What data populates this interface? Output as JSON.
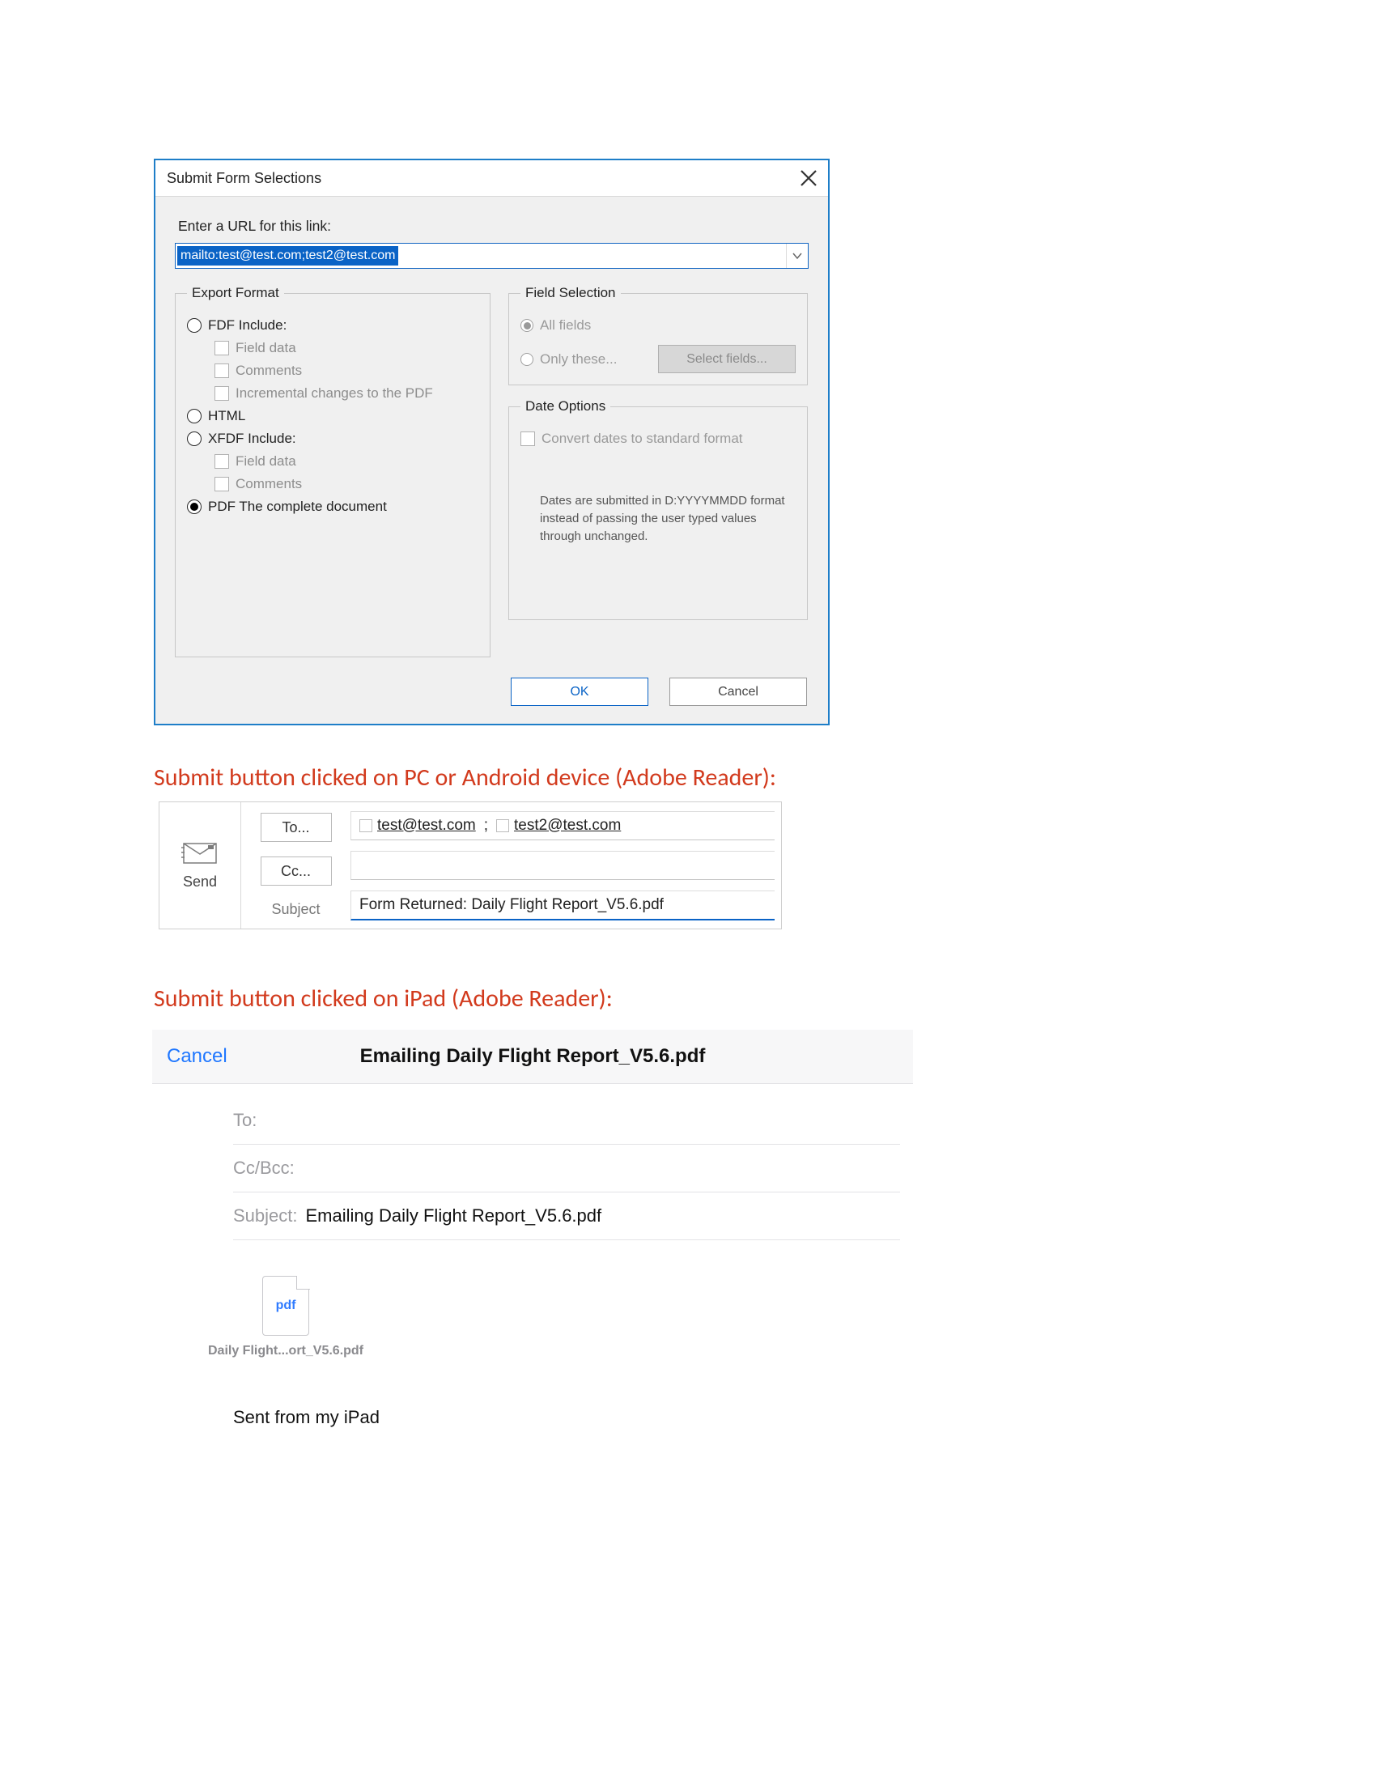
{
  "dialog": {
    "title": "Submit Form Selections",
    "url_label": "Enter a URL for this link:",
    "url_value": "mailto:test@test.com;test2@test.com",
    "export": {
      "legend": "Export Format",
      "fdf": "FDF  Include:",
      "field_data": "Field data",
      "comments": "Comments",
      "incremental": "Incremental changes to the PDF",
      "html": "HTML",
      "xfdf": "XFDF  Include:",
      "pdf": "PDF  The complete document"
    },
    "field_sel": {
      "legend": "Field Selection",
      "all": "All fields",
      "only": "Only these...",
      "select_btn": "Select fields..."
    },
    "date": {
      "legend": "Date Options",
      "convert": "Convert dates to standard format",
      "note": "Dates are submitted in D:YYYYMMDD format instead of passing the user typed values through unchanged."
    },
    "ok": "OK",
    "cancel": "Cancel"
  },
  "captions": {
    "pc": "Submit button clicked on PC or Android device (Adobe Reader):",
    "ipad": "Submit button clicked on iPad (Adobe Reader):"
  },
  "outlook": {
    "send": "Send",
    "to_btn": "To...",
    "cc_btn": "Cc...",
    "subject_label": "Subject",
    "to1": "test@test.com",
    "sep": ";",
    "to2": "test2@test.com",
    "subject": "Form Returned: Daily Flight Report_V5.6.pdf"
  },
  "ipad": {
    "cancel": "Cancel",
    "title": "Emailing Daily Flight Report_V5.6.pdf",
    "to": "To:",
    "ccbcc": "Cc/Bcc:",
    "subject_label": "Subject:",
    "subject": "Emailing Daily Flight Report_V5.6.pdf",
    "attach_badge": "pdf",
    "attach_name": "Daily Flight...ort_V5.6.pdf",
    "signature": "Sent from my iPad"
  }
}
